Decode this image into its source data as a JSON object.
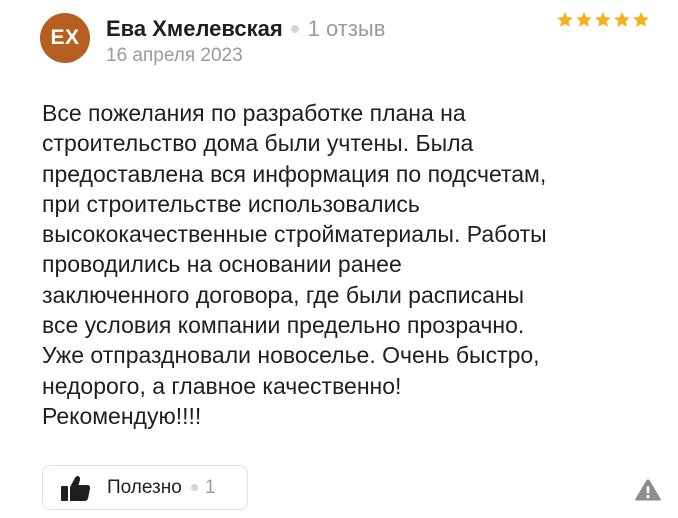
{
  "review": {
    "author": {
      "initials": "ЕХ",
      "name": "Ева Хмелевская",
      "reviews_count": "1 отзыв",
      "avatar_color": "#b65f20"
    },
    "date": "16 апреля 2023",
    "rating": 5,
    "max_rating": 5,
    "star_color": "#f6b01d",
    "text_lines": [
      "Все пожелания по разработке плана на",
      "строительство дома были учтены. Была",
      "предоставлена вся информация по подсчетам,",
      "при строительстве использовались",
      "высококачественные стройматериалы. Работы",
      "проводились на основании ранее",
      "заключенного договора, где были расписаны",
      "все условия компании предельно прозрачно.",
      "Уже отпраздновали новоселье. Очень быстро,",
      "недорого, а главное качественно!",
      "Рекомендую!!!!"
    ]
  },
  "actions": {
    "helpful_label": "Полезно",
    "helpful_count": "1",
    "helpful_icon": "thumbs-up-icon",
    "report_icon": "warning-icon"
  }
}
